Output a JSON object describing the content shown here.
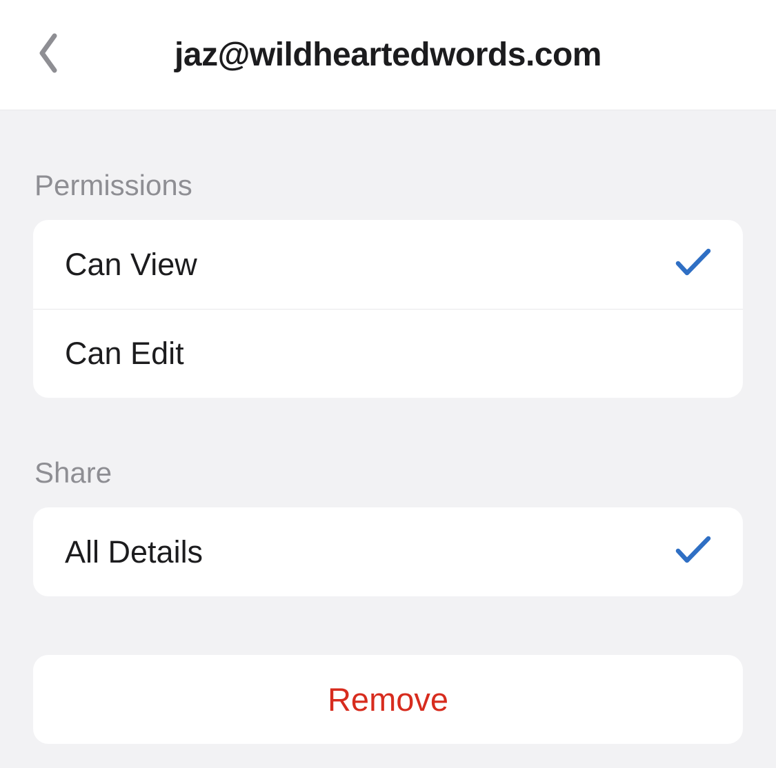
{
  "header": {
    "title": "jaz@wildheartedwords.com"
  },
  "sections": {
    "permissions": {
      "header": "Permissions",
      "items": [
        {
          "label": "Can View",
          "selected": true
        },
        {
          "label": "Can Edit",
          "selected": false
        }
      ]
    },
    "share": {
      "header": "Share",
      "items": [
        {
          "label": "All Details",
          "selected": true
        }
      ]
    }
  },
  "action": {
    "remove": "Remove"
  },
  "colors": {
    "accent": "#2f6fc4",
    "destructive": "#d72c1e",
    "secondary": "#8e8e93"
  }
}
